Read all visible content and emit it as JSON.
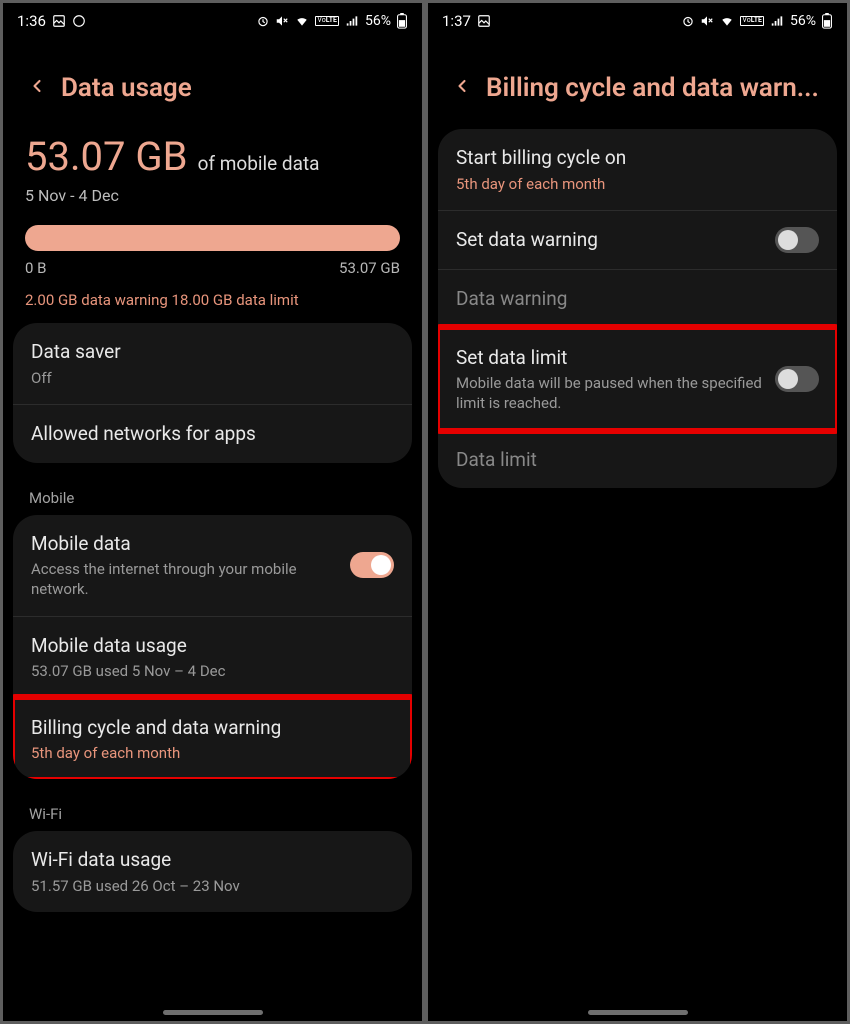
{
  "left": {
    "status": {
      "time": "1:36",
      "batt": "56%"
    },
    "title": "Data usage",
    "usage": {
      "amount": "53.07 GB",
      "of": "of mobile data",
      "period": "5 Nov - 4 Dec",
      "scale_min": "0 B",
      "scale_max": "53.07 GB",
      "warn_text": "2.00 GB data warning  18.00 GB data limit"
    },
    "rows": {
      "data_saver": {
        "label": "Data saver",
        "sub": "Off"
      },
      "allowed_networks": {
        "label": "Allowed networks for apps"
      }
    },
    "mobile_head": "Mobile",
    "mobile": {
      "data": {
        "label": "Mobile data",
        "sub": "Access the internet through your mobile network."
      },
      "usage": {
        "label": "Mobile data usage",
        "sub": "53.07 GB used 5 Nov – 4 Dec"
      },
      "billing": {
        "label": "Billing cycle and data warning",
        "sub": "5th day of each month"
      }
    },
    "wifi_head": "Wi-Fi",
    "wifi": {
      "usage": {
        "label": "Wi-Fi data usage",
        "sub": "51.57 GB used 26 Oct – 23 Nov"
      }
    }
  },
  "right": {
    "status": {
      "time": "1:37",
      "batt": "56%"
    },
    "title": "Billing cycle and data warn...",
    "rows": {
      "start": {
        "label": "Start billing cycle on",
        "sub": "5th day of each month"
      },
      "set_warning": {
        "label": "Set data warning"
      },
      "data_warning": {
        "label": "Data warning"
      },
      "set_limit": {
        "label": "Set data limit",
        "sub": "Mobile data will be paused when the specified limit is reached."
      },
      "data_limit": {
        "label": "Data limit"
      }
    }
  },
  "icons": {
    "volte": "VoLTE"
  }
}
